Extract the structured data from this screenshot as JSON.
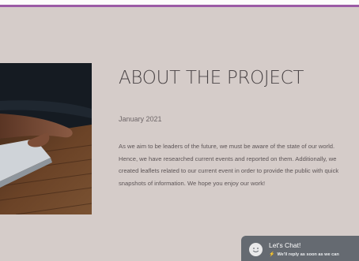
{
  "project": {
    "title": "ABOUT THE PROJECT",
    "date": "January 2021",
    "description": "As we aim to be leaders of the future, we must be aware of the state of our world. Hence, we have researched current events and reported on them. Additionally, we created leaflets related to our current event in order to provide the public with quick snapshots of information. We hope you enjoy our work!"
  },
  "chat_widget": {
    "title": "Let's Chat!",
    "subtitle": "We'll reply as soon as we can",
    "icon": "smiley-icon",
    "bolt_icon": "bolt-icon"
  },
  "image": {
    "subject": "hands typing on laptop on wooden desk"
  },
  "colors": {
    "page_background": "#d5ccc9",
    "accent": "#9b5aa5",
    "chat_background": "#656a71",
    "heading_text": "#4a4446"
  }
}
